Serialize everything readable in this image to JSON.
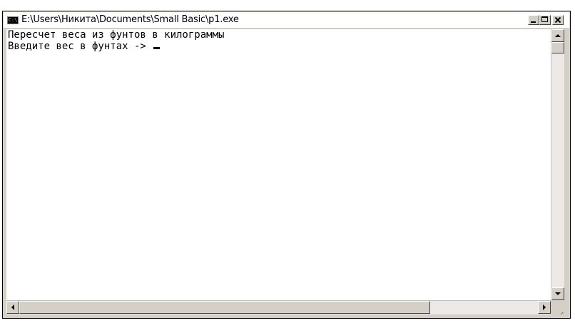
{
  "window": {
    "title": "E:\\Users\\Никита\\Documents\\Small Basic\\p1.exe",
    "icon": "console-icon",
    "icon_glyph": "C:\\"
  },
  "console": {
    "lines": [
      "Пересчет веса из фунтов в килограммы",
      "Введите вес в фунтах -> "
    ]
  },
  "titlebar_buttons": {
    "minimize": "minimize-icon",
    "maximize": "maximize-icon",
    "close": "close-icon"
  }
}
